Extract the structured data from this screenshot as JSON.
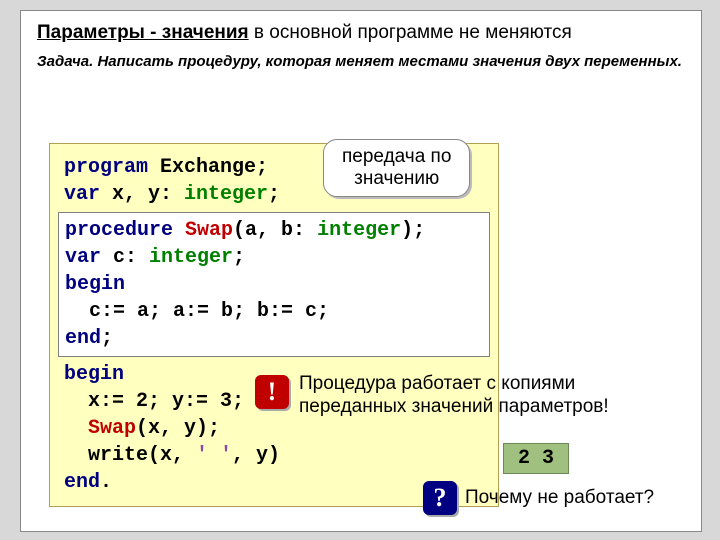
{
  "title_prefix": "Параметры - значения",
  "title_rest": " в основной программе не меняются",
  "task_label": "Задача.",
  "task_text": " Написать процедуру, которая меняет местами значения двух переменных.",
  "code": {
    "l1a": "program",
    "l1b": " Exchange;",
    "l2a": "var",
    "l2b": " x, y: ",
    "l2c": "integer",
    "l2d": ";",
    "l3a": "procedure",
    "l3b": " Swap",
    "l3c": "(a, b: ",
    "l3d": "integer",
    "l3e": ");",
    "l4a": "var",
    "l4b": " c: ",
    "l4c": "integer",
    "l4d": ";",
    "l5": "begin",
    "l6": "  c:= a; a:= b; b:= c;",
    "l7": "end",
    "l8": "begin",
    "l9": "  x:= 2; y:= 3;",
    "l10a": "  ",
    "l10b": "Swap",
    "l10c": "(x, y);",
    "l11a": "  write(x, ",
    "l11b": "' '",
    "l11c": ", y)",
    "l12": "end"
  },
  "callout_top_l1": "передача по",
  "callout_top_l2": "значению",
  "note_copies_l1": "Процедура работает с копиями",
  "note_copies_l2": "переданных значений параметров!",
  "output": "2 3",
  "why": "Почему не работает?",
  "badge_excl": "!",
  "badge_ques": "?"
}
